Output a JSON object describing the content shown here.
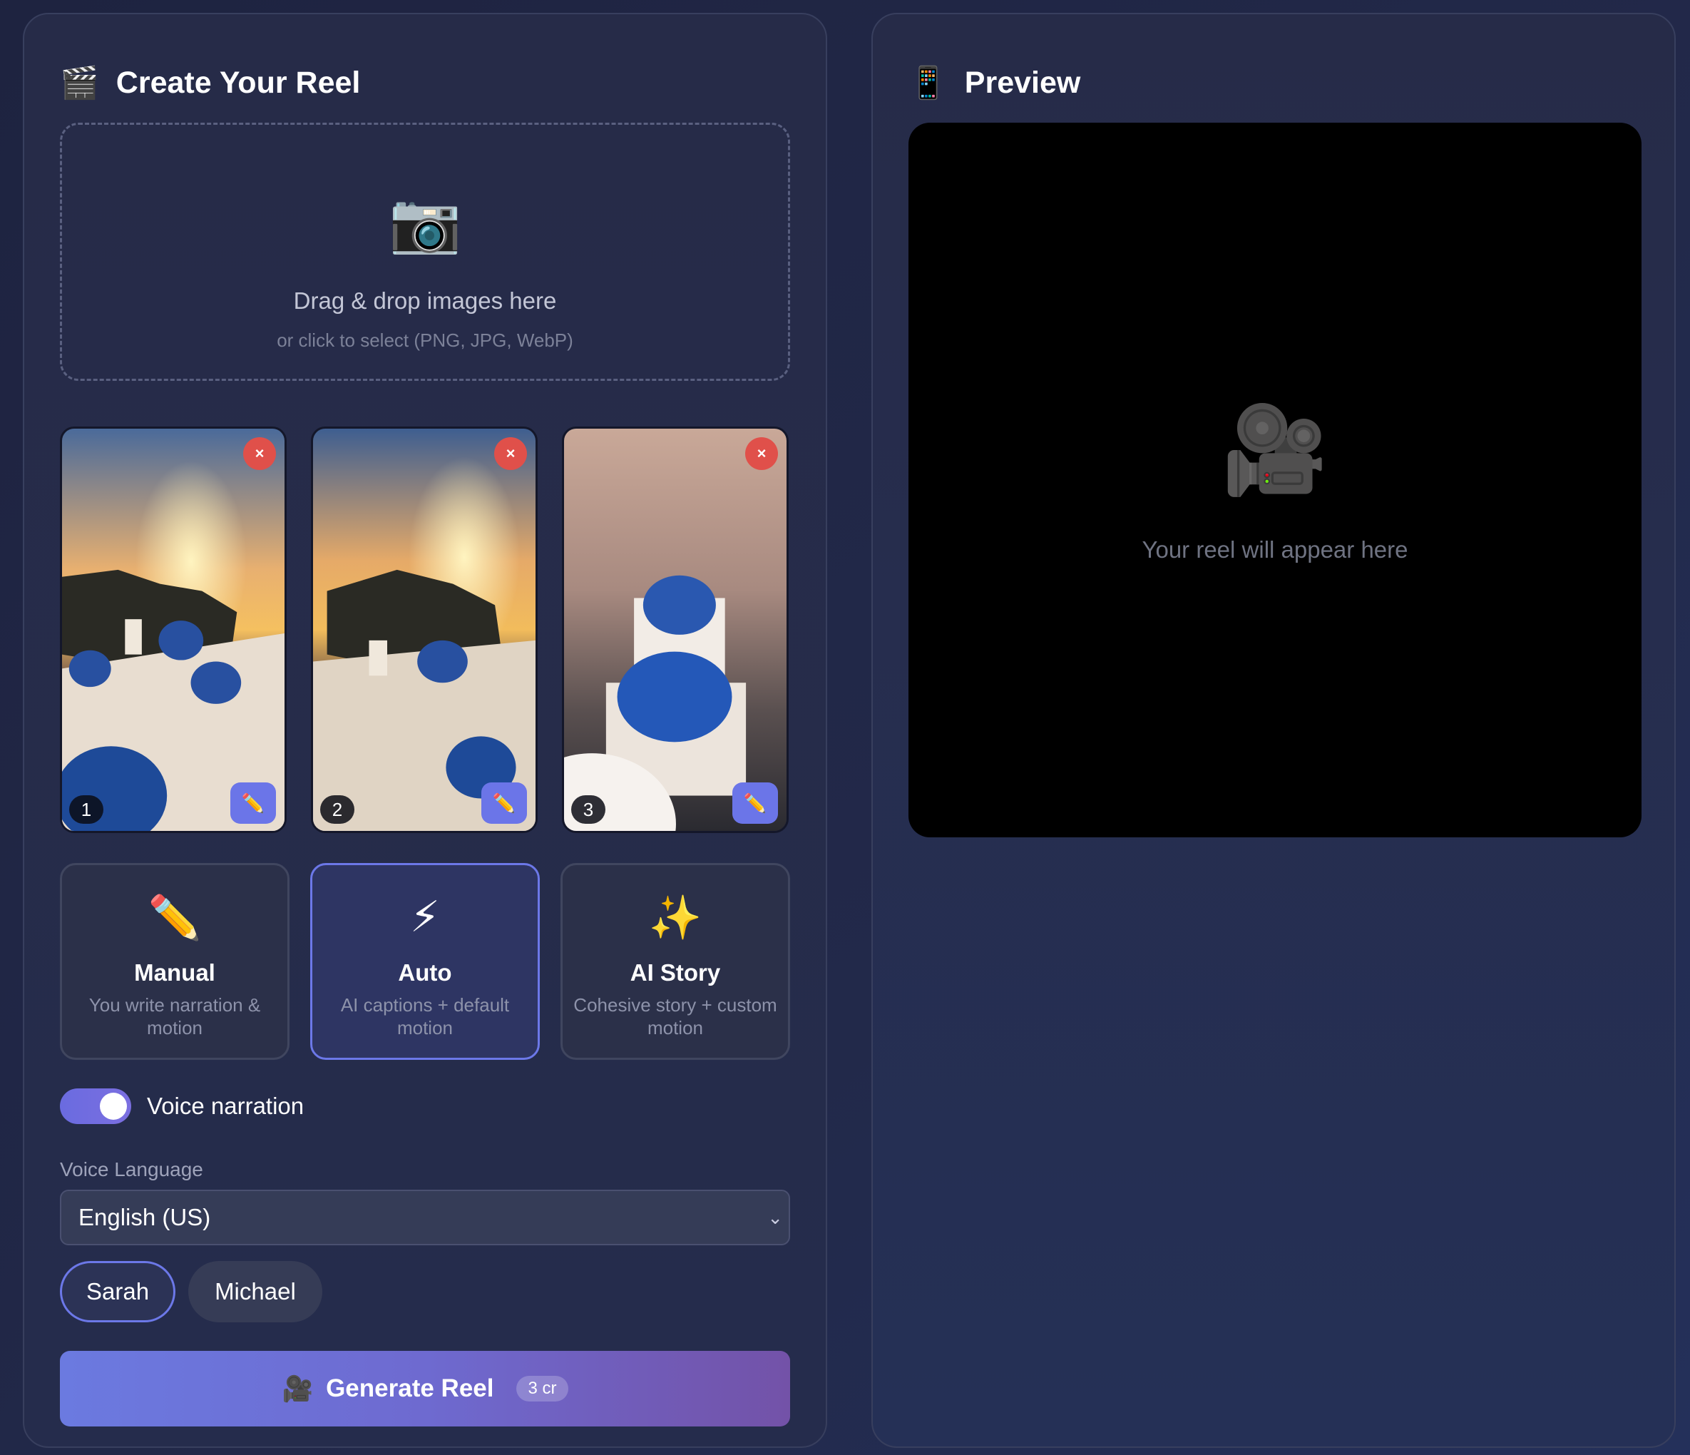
{
  "create": {
    "icon": "clapper-board-icon",
    "title": "Create Your Reel",
    "dropzone": {
      "icon": "camera-icon",
      "title": "Drag & drop images here",
      "subtitle": "or click to select (PNG, JPG, WebP)"
    },
    "images": [
      {
        "number": "1",
        "remove": "×",
        "edit_icon": "pencil-icon"
      },
      {
        "number": "2",
        "remove": "×",
        "edit_icon": "pencil-icon"
      },
      {
        "number": "3",
        "remove": "×",
        "edit_icon": "pencil-icon"
      }
    ],
    "modes": [
      {
        "icon": "pencil-icon",
        "title": "Manual",
        "desc": "You write narration & motion",
        "selected": false
      },
      {
        "icon": "lightning-icon",
        "title": "Auto",
        "desc": "AI captions + default motion",
        "selected": true
      },
      {
        "icon": "sparkles-icon",
        "title": "AI Story",
        "desc": "Cohesive story + custom motion",
        "selected": false
      }
    ],
    "voice_narration": {
      "label": "Voice narration",
      "enabled": true
    },
    "voice_language": {
      "label": "Voice Language",
      "value": "English (US)"
    },
    "voices": [
      {
        "name": "Sarah",
        "selected": true
      },
      {
        "name": "Michael",
        "selected": false
      }
    ],
    "generate": {
      "icon": "movie-camera-icon",
      "label": "Generate Reel",
      "cost": "3 cr"
    }
  },
  "preview": {
    "icon": "phone-icon",
    "title": "Preview",
    "placeholder_icon": "film-camera-icon",
    "placeholder_text": "Your reel will appear here"
  },
  "colors": {
    "accent": "#6c78e8",
    "remove": "#e0504a",
    "panel_border": "#383f5e"
  }
}
